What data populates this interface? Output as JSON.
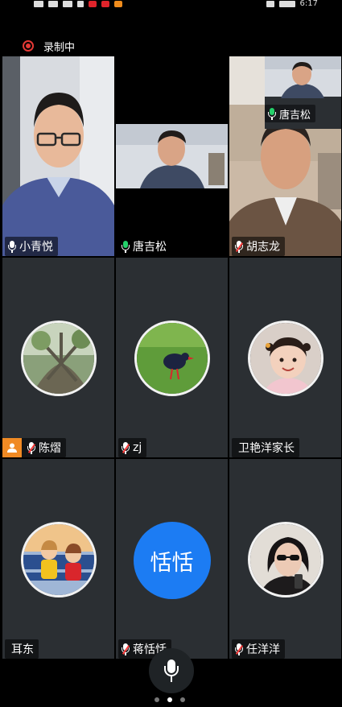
{
  "status_bar": {
    "time": "6:17"
  },
  "recording": {
    "label": "录制中",
    "color": "#e53935"
  },
  "accent": {
    "active_border": "#1ec76a",
    "host_badge": "#f08a24",
    "text_avatar": "#1c7cf3"
  },
  "pip": {
    "name": "唐吉松"
  },
  "participants": [
    {
      "name": "小青悦",
      "mic": "on",
      "type": "video"
    },
    {
      "name": "唐吉松",
      "mic": "speaking",
      "type": "video",
      "active": true
    },
    {
      "name": "胡志龙",
      "mic": "muted",
      "type": "video"
    },
    {
      "name": "陈熠",
      "mic": "muted",
      "type": "avatar",
      "host": true,
      "avatar_icon": "tree-photo-avatar"
    },
    {
      "name": "zj",
      "mic": "muted",
      "type": "avatar",
      "avatar_icon": "bird-photo-avatar"
    },
    {
      "name": "卫艳洋家长",
      "mic": "none",
      "type": "avatar",
      "avatar_icon": "child-photo-avatar"
    },
    {
      "name": "耳东",
      "mic": "none",
      "type": "avatar",
      "avatar_icon": "kids-photo-avatar"
    },
    {
      "name": "蒋恬恬",
      "mic": "muted",
      "type": "text-avatar",
      "avatar_text": "恬恬"
    },
    {
      "name": "任洋洋",
      "mic": "muted",
      "type": "avatar",
      "avatar_icon": "woman-photo-avatar"
    }
  ],
  "controls": {
    "mic_icon": "microphone-icon",
    "pages": 3,
    "current_page": 2
  }
}
